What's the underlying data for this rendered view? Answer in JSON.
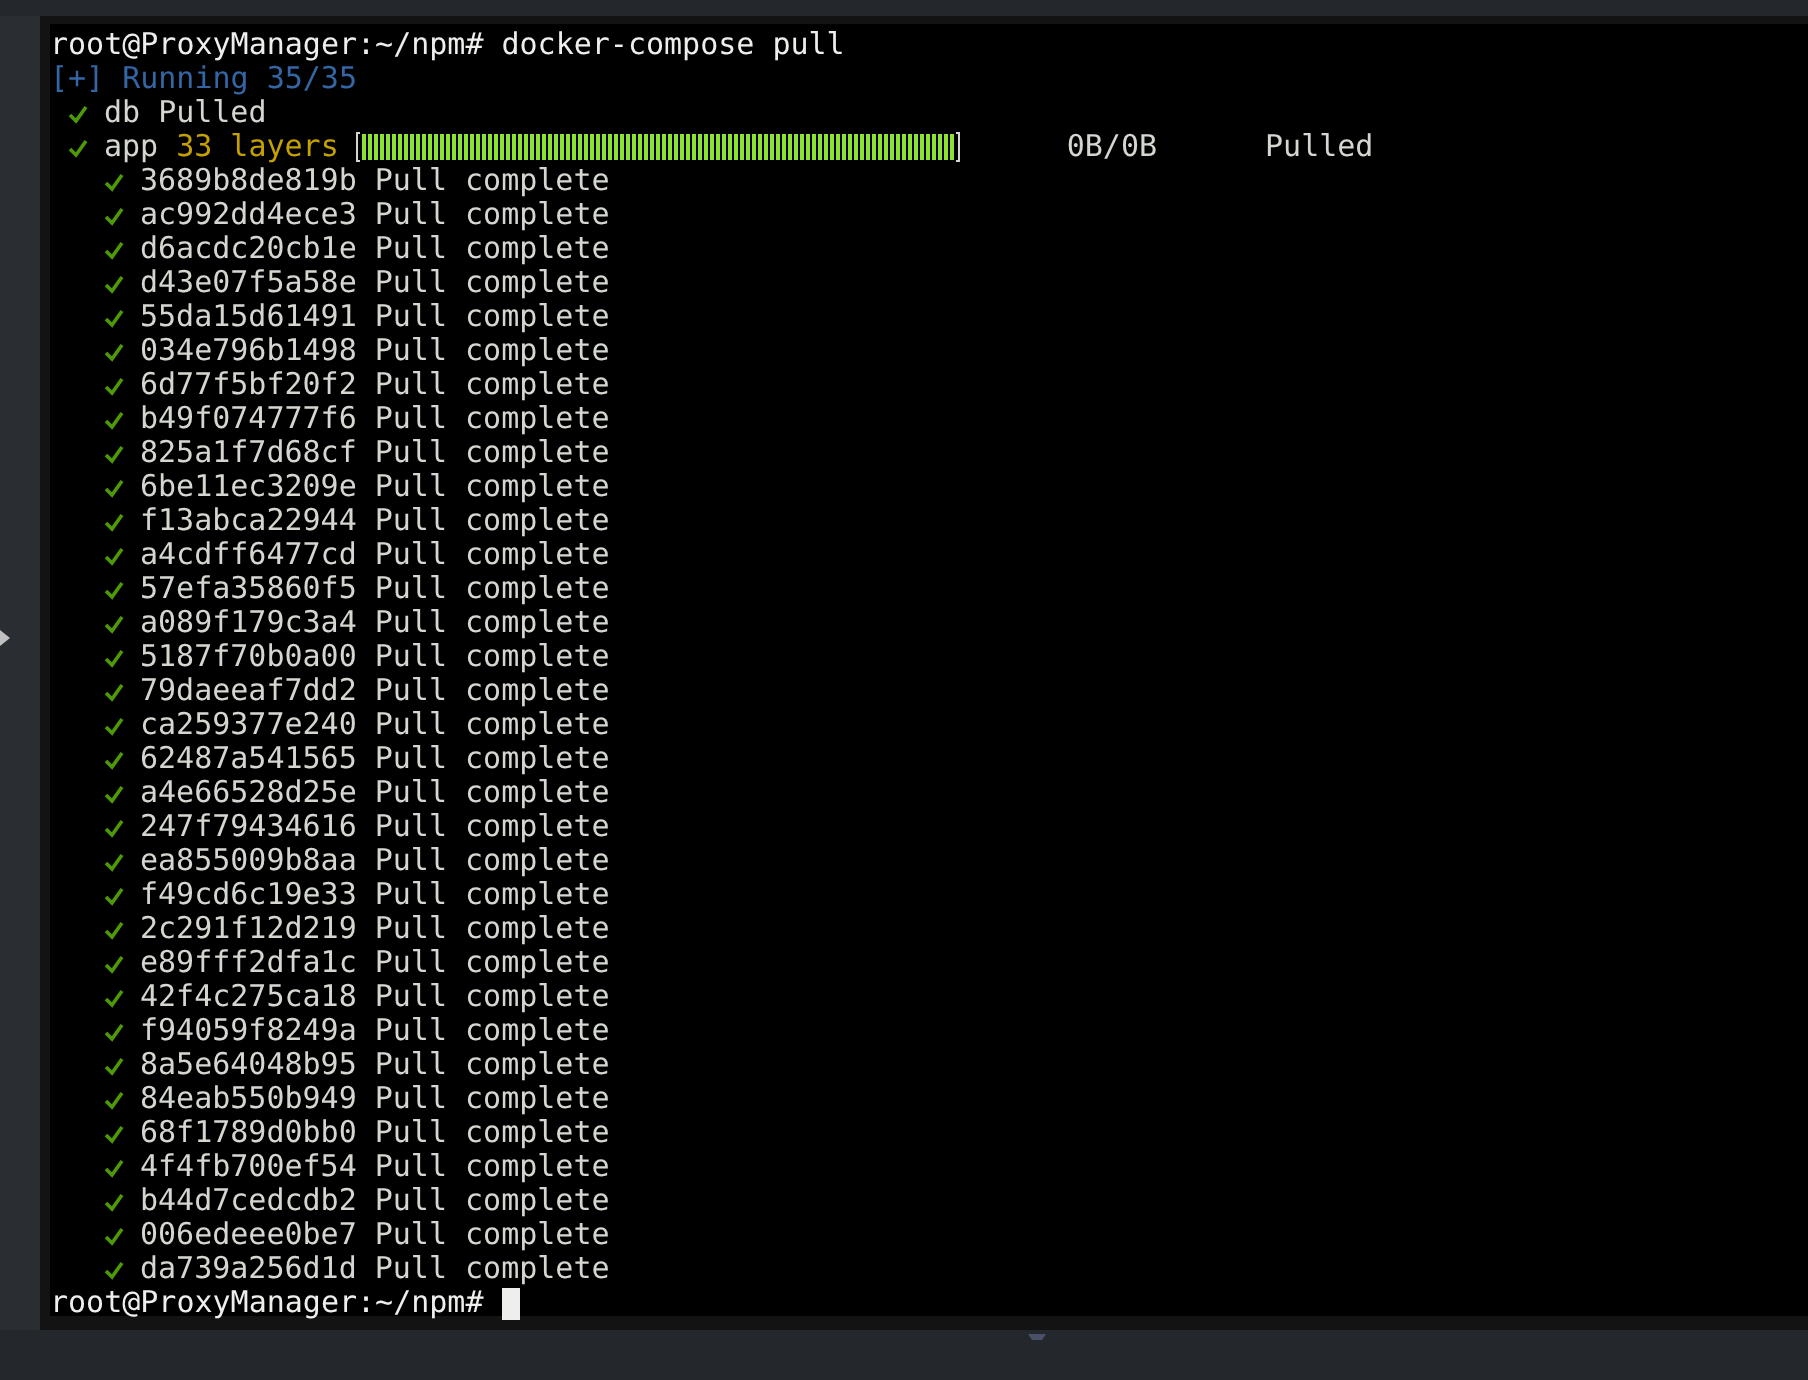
{
  "terminal": {
    "command_line": {
      "prompt": "root@ProxyManager:~/npm#",
      "command": "docker-compose pull"
    },
    "status": {
      "marker": "[+]",
      "text": "Running 35/35"
    },
    "services": [
      {
        "kind": "simple",
        "name": "db",
        "done": true,
        "status": "Pulled"
      },
      {
        "kind": "progress",
        "name": "app",
        "done": true,
        "detail": "33 layers",
        "level": 1,
        "size": "0B/0B",
        "status": "Pulled"
      }
    ],
    "layers": [
      {
        "id": "3689b8de819b",
        "status": "Pull complete",
        "done": true
      },
      {
        "id": "ac992dd4ece3",
        "status": "Pull complete",
        "done": true
      },
      {
        "id": "d6acdc20cb1e",
        "status": "Pull complete",
        "done": true
      },
      {
        "id": "d43e07f5a58e",
        "status": "Pull complete",
        "done": true
      },
      {
        "id": "55da15d61491",
        "status": "Pull complete",
        "done": true
      },
      {
        "id": "034e796b1498",
        "status": "Pull complete",
        "done": true
      },
      {
        "id": "6d77f5bf20f2",
        "status": "Pull complete",
        "done": true
      },
      {
        "id": "b49f074777f6",
        "status": "Pull complete",
        "done": true
      },
      {
        "id": "825a1f7d68cf",
        "status": "Pull complete",
        "done": true
      },
      {
        "id": "6be11ec3209e",
        "status": "Pull complete",
        "done": true
      },
      {
        "id": "f13abca22944",
        "status": "Pull complete",
        "done": true
      },
      {
        "id": "a4cdff6477cd",
        "status": "Pull complete",
        "done": true
      },
      {
        "id": "57efa35860f5",
        "status": "Pull complete",
        "done": true
      },
      {
        "id": "a089f179c3a4",
        "status": "Pull complete",
        "done": true
      },
      {
        "id": "5187f70b0a00",
        "status": "Pull complete",
        "done": true
      },
      {
        "id": "79daeeaf7dd2",
        "status": "Pull complete",
        "done": true
      },
      {
        "id": "ca259377e240",
        "status": "Pull complete",
        "done": true
      },
      {
        "id": "62487a541565",
        "status": "Pull complete",
        "done": true
      },
      {
        "id": "a4e66528d25e",
        "status": "Pull complete",
        "done": true
      },
      {
        "id": "247f79434616",
        "status": "Pull complete",
        "done": true
      },
      {
        "id": "ea855009b8aa",
        "status": "Pull complete",
        "done": true
      },
      {
        "id": "f49cd6c19e33",
        "status": "Pull complete",
        "done": true
      },
      {
        "id": "2c291f12d219",
        "status": "Pull complete",
        "done": true
      },
      {
        "id": "e89fff2dfa1c",
        "status": "Pull complete",
        "done": true
      },
      {
        "id": "42f4c275ca18",
        "status": "Pull complete",
        "done": true
      },
      {
        "id": "f94059f8249a",
        "status": "Pull complete",
        "done": true
      },
      {
        "id": "8a5e64048b95",
        "status": "Pull complete",
        "done": true
      },
      {
        "id": "84eab550b949",
        "status": "Pull complete",
        "done": true
      },
      {
        "id": "68f1789d0bb0",
        "status": "Pull complete",
        "done": true
      },
      {
        "id": "4f4fb700ef54",
        "status": "Pull complete",
        "done": true
      },
      {
        "id": "b44d7cedcdb2",
        "status": "Pull complete",
        "done": true
      },
      {
        "id": "006edeee0be7",
        "status": "Pull complete",
        "done": true
      },
      {
        "id": "da739a256d1d",
        "status": "Pull complete",
        "done": true
      }
    ],
    "final_prompt": "root@ProxyManager:~/npm#"
  }
}
